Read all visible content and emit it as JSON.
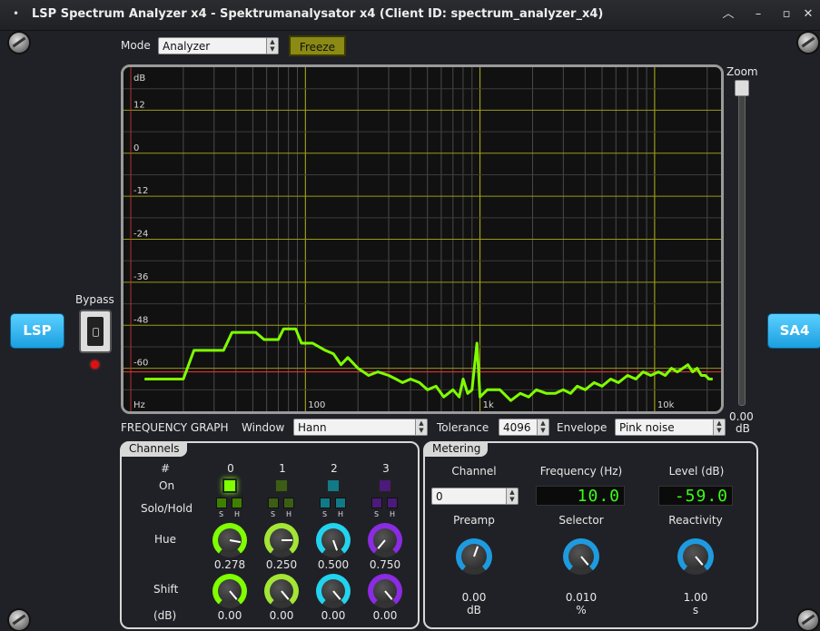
{
  "window": {
    "title": "LSP Spectrum Analyzer x4 - Spektrumanalysator x4 (Client ID: spectrum_analyzer_x4)",
    "menu_glyph": "•",
    "min_glyph": "–",
    "max_glyph": "▫",
    "close_glyph": "✕"
  },
  "top": {
    "mode_label": "Mode",
    "mode_value": "Analyzer",
    "freeze_label": "Freeze",
    "zoom_label": "Zoom",
    "zoom_value": "0.00",
    "zoom_unit": "dB"
  },
  "side": {
    "lsp_label": "LSP",
    "sa4_label": "SA4",
    "bypass_label": "Bypass"
  },
  "graph": {
    "y_unit": "dB",
    "y_ticks": [
      "12",
      "0",
      "-12",
      "-24",
      "-36",
      "-48",
      "-60"
    ],
    "x_unit": "Hz",
    "x_ticks": [
      "100",
      "1k",
      "10k"
    ],
    "trace_color": "#7fff00",
    "threshold_color": "#e03030"
  },
  "chart_data": {
    "type": "line",
    "title": "",
    "xlabel": "Hz",
    "ylabel": "dB",
    "x_scale": "log",
    "xlim": [
      10,
      24000
    ],
    "ylim": [
      -72,
      24
    ],
    "series": [
      {
        "color": "#7fff00",
        "x": [
          12,
          20,
          23,
          34,
          38,
          52,
          58,
          70,
          75,
          88,
          95,
          110,
          130,
          145,
          160,
          175,
          200,
          230,
          260,
          300,
          330,
          360,
          400,
          450,
          500,
          560,
          620,
          700,
          760,
          800,
          850,
          900,
          960,
          1000,
          1100,
          1300,
          1500,
          1700,
          1900,
          2100,
          2400,
          2700,
          3000,
          3300,
          3600,
          4000,
          4500,
          5000,
          5600,
          6200,
          7000,
          7800,
          8600,
          9500,
          10500,
          11500,
          12500,
          13500,
          14500,
          15500,
          16500,
          17500,
          18500,
          19500,
          20500,
          21500
        ],
        "y": [
          -63,
          -63,
          -55,
          -55,
          -50,
          -50,
          -52,
          -52,
          -49,
          -49,
          -53,
          -53,
          -55,
          -56,
          -59,
          -57,
          -60,
          -62,
          -61,
          -62,
          -63,
          -64,
          -63,
          -64,
          -66,
          -65,
          -68,
          -66,
          -68,
          -63,
          -67,
          -66,
          -53,
          -68,
          -66,
          -66,
          -69,
          -67,
          -68,
          -66,
          -67,
          -67,
          -66,
          -67,
          -65,
          -66,
          -64,
          -65,
          -63,
          -64,
          -62,
          -63,
          -61,
          -62,
          -61,
          -62,
          -60,
          -61,
          -60,
          -59,
          -61,
          -60,
          -62,
          -62,
          -63,
          -63
        ]
      }
    ]
  },
  "bottom_bar": {
    "freq_graph_label": "FREQUENCY GRAPH",
    "window_label": "Window",
    "window_value": "Hann",
    "tolerance_label": "Tolerance",
    "tolerance_value": "4096",
    "envelope_label": "Envelope",
    "envelope_value": "Pink noise"
  },
  "channels": {
    "title": "Channels",
    "hash_label": "#",
    "on_label": "On",
    "soloh_label": "Solo/Hold",
    "hue_label": "Hue",
    "shift_label": "Shift",
    "shift_unit_label": "(dB)",
    "s_label": "S",
    "h_label": "H",
    "items": [
      {
        "num": "0",
        "hue": "0.278",
        "shift": "0.00",
        "color": "#7fff00"
      },
      {
        "num": "1",
        "hue": "0.250",
        "shift": "0.00",
        "color": "#a3e635"
      },
      {
        "num": "2",
        "hue": "0.500",
        "shift": "0.00",
        "color": "#22d3ee"
      },
      {
        "num": "3",
        "hue": "0.750",
        "shift": "0.00",
        "color": "#8b2be2"
      }
    ]
  },
  "metering": {
    "title": "Metering",
    "channel_label": "Channel",
    "channel_value": "0",
    "frequency_label": "Frequency (Hz)",
    "frequency_value": "10.0",
    "level_label": "Level (dB)",
    "level_value": "-59.0",
    "preamp_label": "Preamp",
    "preamp_value": "0.00",
    "preamp_unit": "dB",
    "selector_label": "Selector",
    "selector_value": "0.010",
    "selector_unit": "%",
    "reactivity_label": "Reactivity",
    "reactivity_value": "1.00",
    "reactivity_unit": "s",
    "knob_color": "#1e9be0"
  }
}
